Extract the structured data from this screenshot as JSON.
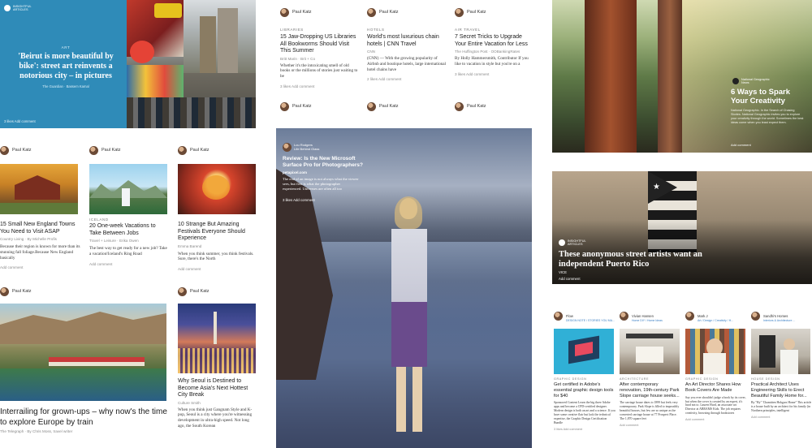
{
  "panel1": {
    "hero": {
      "source_line1": "INSIGHTFUL",
      "source_line2": "ARTICLES",
      "tag": "ART",
      "title": "'Beirut is more beautiful by bike': street art reinvents a notorious city – in pictures",
      "byline": "The Guardian · Bassem Kamal",
      "actions": "3 likes   Add comment"
    },
    "cards": [
      {
        "author": "Paul Katz",
        "tag": "",
        "title": "15 Small New England Towns You Need to Visit ASAP",
        "meta": "Country Living · By Michelle Profis",
        "desc": "Because their region is known for more than its stunning fall foliage.Because New England basically",
        "actions": "Add comment"
      },
      {
        "author": "Paul Katz",
        "tag": "ICELAND",
        "title": "20 One-week Vacations to Take Between Jobs",
        "meta": "Travel + Leisure · Erika Owen",
        "desc": "The best way to get ready for a new job? Take a vacation!Iceland's Ring Road",
        "actions": "Add comment"
      },
      {
        "author": "Paul Katz",
        "tag": "",
        "title": "10 Strange But Amazing Festivals Everyone Should Experience",
        "meta": "Emma Barend",
        "desc": "When you think summer, you think festivals. Sure, there's the North",
        "actions": "Add comment"
      },
      {
        "author": "Paul Katz",
        "title": "Interrailing for grown-ups – why now's the time to explore Europe by train",
        "meta": "The Telegraph · By Chris Moss, travel writer"
      },
      {
        "author": "Paul Katz",
        "title": "Why Seoul is Destined to Become Asia's Next Hottest City Break",
        "meta": "Culture Smith",
        "desc": "When you think just Gangnam Style and K-pop, Seoul is a city where you're witnessing development in ultra-high speed. Not long ago, the South Korean"
      }
    ]
  },
  "panel2": {
    "cards": [
      {
        "author": "Paul Katz",
        "tag": "LIBRARIES",
        "title": "15 Jaw-Dropping US Libraries All Bookworms Should Visit This Summer",
        "meta": "Britt Marin · Brit + Co",
        "desc": "Whether it's the intoxicating smell of old books or the millions of stories just waiting to be",
        "actions": "3 likes   Add comment"
      },
      {
        "author": "Paul Katz",
        "tag": "HOTELS",
        "title": "World's most luxurious chain hotels | CNN Travel",
        "meta": "CNN",
        "desc": "(CNN) — With the growing popularity of Airbnb and boutique hotels, large international hotel chains have",
        "actions": "2 likes   Add comment"
      },
      {
        "author": "Paul Katz",
        "tag": "AIR TRAVEL",
        "title": "7 Secret Tricks to Upgrade Your Entire Vacation for Less",
        "meta": "The Huffington Post · OOBankingRates",
        "desc": "By Holly Hammersmith, Contributor If you like to vacation in style but you're on a",
        "actions": "3 likes   Add comment"
      }
    ],
    "bottom_authors": [
      "Paul Katz",
      "Paul Katz",
      "Paul Katz"
    ],
    "surface": {
      "source_line1": "Lou Rodgers",
      "source_line2": "Life Behind Glass",
      "title": "Review: Is the New Microsoft Surface Pro for Photographers?",
      "site": "petapixel.com",
      "desc": "The end of an image is not always what the viewer sees, but first is what the photographer experienced. Universes are often all too",
      "actions": "3 likes   Add comment"
    }
  },
  "panel3": {
    "forest": {
      "source_line1": "National Geographic",
      "source_line2": "News",
      "title": "6 Ways to Spark Your Creativity",
      "desc": "National Geographic. In the Search of Chasing Stories. National Geographic invites you to explore your creativity through the world. Sometimes the best ideas come when you least expect them.",
      "actions": "Add comment"
    },
    "puerto": {
      "source_line1": "INSIGHTFUL",
      "source_line2": "ARTICLES",
      "title": "These anonymous street artists want an independent Puerto Rico",
      "source": "VICE",
      "actions": "Add comment"
    },
    "cards": [
      {
        "author": "Flow",
        "sub": "DESIGN NOTE / STORIES YOU MA...",
        "tag": "GRAPHIC DESIGN",
        "title": "Get certified in Adobe's essential graphic design tools for $40",
        "desc": "Sponsored Content Learn the big three Adobe apps and become a CPD-certified designer. Modern design is both an art and a science. If you have some creative flair but lack the technical expertise, the Graphic Design Certification Bundle",
        "actions": "3 likes   Add comment"
      },
      {
        "author": "Vivian Hansen",
        "sub": "Home DIY / Home Ideas",
        "tag": "ARCHITECTURE",
        "title": "After contemporary renovation, 19th-century Park Slope carriage house seeks...",
        "desc": "The carriage house dates to 1899 but feels very contemporary. Park Slope is filled to impossibly beautiful houses, but few are so unique as the converted carriage house at 77 Prospect Place. The 1,870 square feet",
        "actions": "Add comment"
      },
      {
        "author": "Mark J",
        "sub": "Art / Design / Creativity / H...",
        "tag": "GRAPHIC DESIGN",
        "title": "An Art Director Shares How Book Covers Are Made",
        "desc": "Say you ever shouldn't judge a book by its cover, but when the cover is created by an expert, it's hard not to. Lauren Hurd, an associate art Director at ABRAMS Kids. The job requires creativity, browsing through bookstores",
        "actions": "Add comment"
      },
      {
        "author": "Sandhi's Homes",
        "sub": "Interiors & Architecture ...",
        "tag": "HOUSE DESIGN",
        "title": "Practical Architect Uses Engineering Skills to Erect Beautiful Family Home for...",
        "desc": "By \"Hy\" 'Chamitten Hokgars Home\" This article is a house built by an architect for his family (in Northern principles, intelligent",
        "actions": "Add comment"
      }
    ]
  },
  "colors": {
    "hero_blue": "#2f8bb8",
    "iceland_sky": "#9cd2ee"
  }
}
